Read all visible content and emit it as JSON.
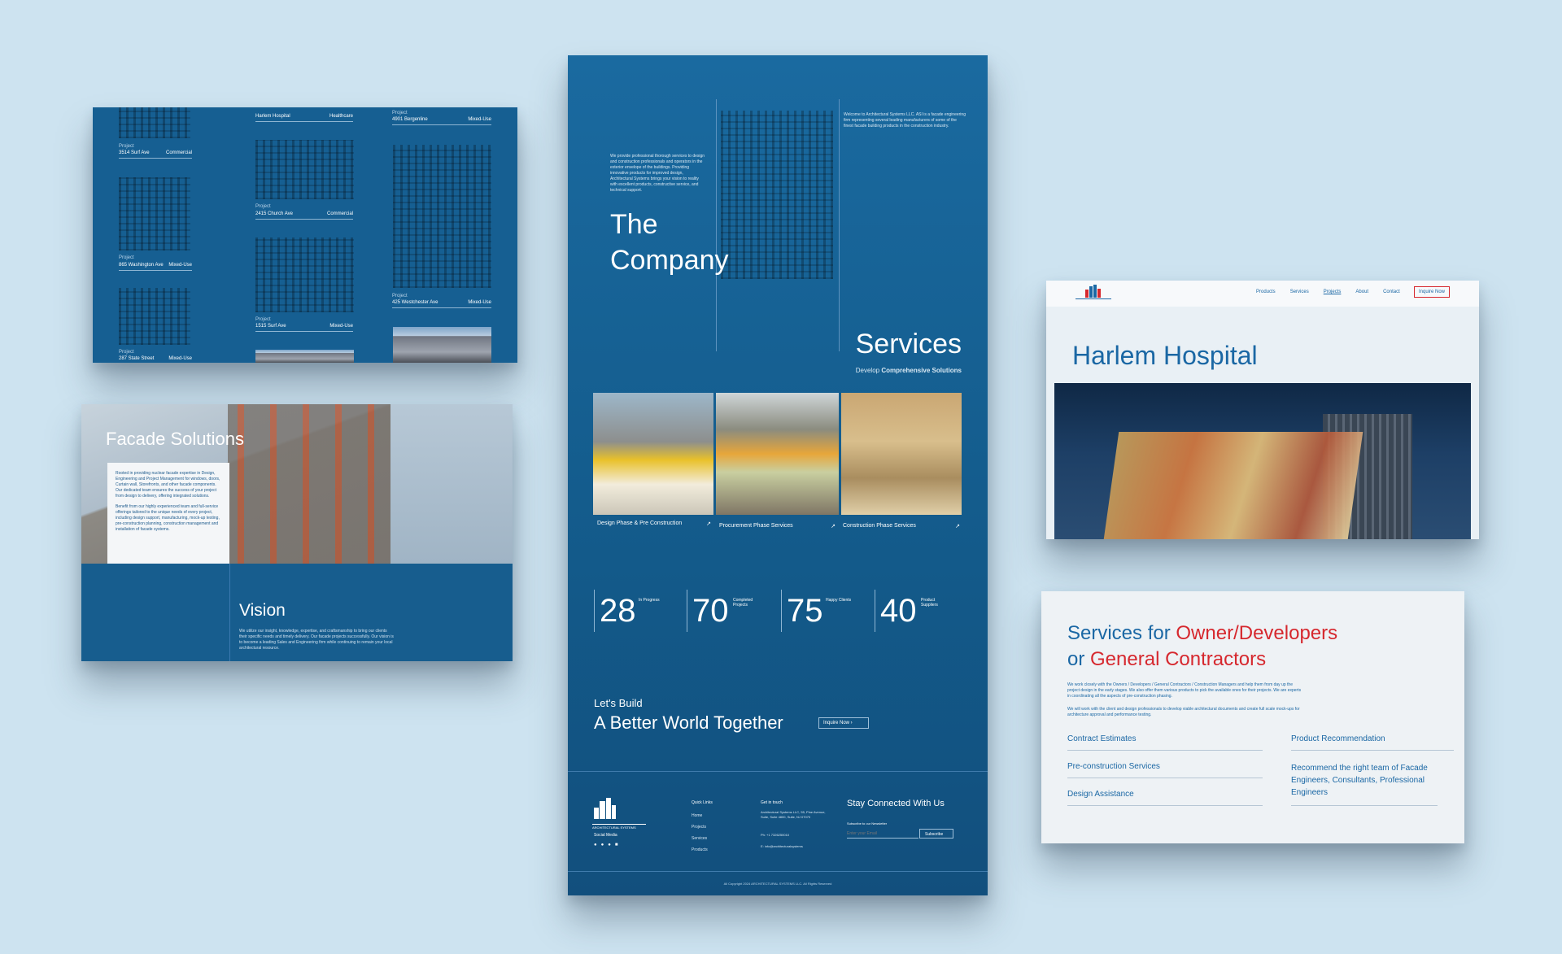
{
  "card_projects": {
    "project_label": "Project",
    "col1": [
      {
        "name": "3514 Surf Ave",
        "type": "Commercial"
      },
      {
        "name": "865 Washington Ave",
        "type": "Mixed-Use"
      },
      {
        "name": "287 State Street",
        "type": "Mixed-Use"
      }
    ],
    "col2": [
      {
        "name": "Harlem Hospital",
        "type": "Healthcare"
      },
      {
        "name": "2415 Church Ave",
        "type": "Commercial"
      },
      {
        "name": "1515 Surf Ave",
        "type": "Mixed-Use"
      }
    ],
    "col3": [
      {
        "name": "4901 Bergenline",
        "type": "Mixed-Use"
      },
      {
        "name": "425 Westchester Ave",
        "type": "Mixed-Use"
      }
    ]
  },
  "card_facade": {
    "title": "Facade Solutions",
    "para1": "Rooted in providing nuclear facade expertise in Design, Engineering and Project Management for windows, doors, Curtain wall, Storefronts, and other facade components. Our dedicated team ensures the success of your project from design to delivery, offering integrated solutions.",
    "para2": "Benefit from our highly experienced team and full-service offerings tailored to the unique needs of every project, including design support, manufacturing, mock-up testing, pre-construction planning, construction management and installation of facade systems.",
    "vision_title": "Vision",
    "vision_text": "We utilize our insight, knowledge, expertise, and craftsmanship to bring our clients their specific needs and timely delivery. Our facade projects successfully. Our vision is to become a leading Sales and Engineering firm while continuing to remain your local architectural resource."
  },
  "card_main": {
    "intro_left": "We provide professional thorough services to design and construction professionals and operators in the exterior envelope of the buildings. Providing innovative products for improved design, Architectural Systems brings your vision to reality with excellent products, constructive service, and technical support.",
    "intro_right": "Welcome to Architectural Systems LLC. ASI is a facade engineering firm representing several leading manufacturers of some of the finest facade building products in the construction industry.",
    "company_title_1": "The",
    "company_title_2": "Company",
    "services_title": "Services",
    "services_sub_plain": "Develop ",
    "services_sub_bold": "Comprehensive Solutions",
    "services": [
      {
        "label": "Design Phase & Pre Construction"
      },
      {
        "label": "Procurement Phase Services"
      },
      {
        "label": "Construction Phase Services"
      }
    ],
    "arrow": "↗",
    "stats": [
      {
        "value": "28",
        "label": "In Progress"
      },
      {
        "value": "70",
        "label": "Completed Projects"
      },
      {
        "value": "75",
        "label": "Happy Clients"
      },
      {
        "value": "40",
        "label": "Product Suppliers"
      }
    ],
    "cta_small": "Let's Build",
    "cta_big": "A Better World Together",
    "cta_button": "Inquire Now",
    "footer": {
      "logo_text": "ARCHITECTURAL SYSTEMS",
      "social_label": "Social Media",
      "quick_links_title": "Quick Links",
      "quick_links": [
        "Home",
        "Projects",
        "Services",
        "Products"
      ],
      "reach_title": "Get in touch",
      "address": "Architectural Systems LLC, 55, Pine Avenue, Suite, Suite 4800, Suite, NJ 07070",
      "phone": "Ph: +1 7326250010",
      "email": "E: info@architecturalsystems",
      "stay_title": "Stay Connected With Us",
      "newsletter_label": "Subscribe to our Newsletter",
      "email_placeholder": "Enter your Email",
      "subscribe_label": "Subscribe",
      "copyright": "All Copyright 2024 ARCHITECTURAL SYSTEMS LLC. All Rights Reserved"
    }
  },
  "card_harlem": {
    "nav": [
      "Products",
      "Services",
      "Projects",
      "About",
      "Contact"
    ],
    "inquire": "Inquire Now",
    "title": "Harlem Hospital"
  },
  "card_services_owner": {
    "title_a": "Services for ",
    "title_b": "Owner/Developers",
    "title_c": "or ",
    "title_d": "General Contractors",
    "para1": "We work closely with the Owners / Developers / General Contractors / Construction Managers and help them from day up the project design in the early stages. We also offer them various products to pick the available ones for their projects. We are experts in coordinating all the aspects of pre-construction phasing.",
    "para2": "We will work with the client and design professionals to develop viable architectural documents and create full scale mock-ups for architecture approval and performance testing.",
    "left_items": [
      "Contract Estimates",
      "Pre-construction Services",
      "Design Assistance"
    ],
    "right_items": [
      "Product Recommendation",
      "Recommend the right team of Facade Engineers, Consultants, Professional Engineers"
    ]
  }
}
